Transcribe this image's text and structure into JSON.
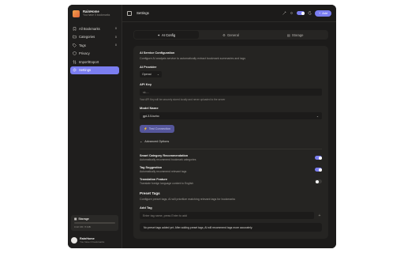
{
  "brand": {
    "title": "RainHome",
    "subtitle": "You have 0 bookmarks"
  },
  "sidebar": {
    "items": [
      {
        "label": "All Bookmarks",
        "count": "0",
        "icon": "bookmark-icon"
      },
      {
        "label": "Categories",
        "count": "0",
        "icon": "folder-icon"
      },
      {
        "label": "Tags",
        "count": "0",
        "icon": "tag-icon"
      },
      {
        "label": "Privacy",
        "count": "",
        "icon": "shield-icon"
      },
      {
        "label": "Import/Export",
        "count": "",
        "icon": "import-export-icon"
      },
      {
        "label": "Settings",
        "count": "",
        "icon": "gear-icon",
        "active": true
      }
    ]
  },
  "storage": {
    "title": "Storage",
    "usage": "0.02 KB / 5 MB"
  },
  "user": {
    "name": "RainHome",
    "subtitle": "You have 0 bookmarks"
  },
  "topbar": {
    "title": "Settings",
    "add_label": "Add"
  },
  "tabs": [
    {
      "label": "AI Config",
      "active": true
    },
    {
      "label": "General",
      "active": false
    },
    {
      "label": "Storage",
      "active": false
    }
  ],
  "ai": {
    "section_title": "AI Service Configuration",
    "section_desc": "Configure AI analysis service to automatically extract bookmark summaries and tags",
    "provider_label": "AI Provider",
    "provider_value": "Openai",
    "apikey_label": "API Key",
    "apikey_placeholder": "sk-...",
    "apikey_hint": "Your API Key will be securely stored locally and never uploaded to the server",
    "model_label": "Model Name",
    "model_value": "gpt-3.5-turbo",
    "test_label": "Test Connection",
    "advanced_label": "Advanced Options"
  },
  "toggles": [
    {
      "title": "Smart Category Recommendation",
      "desc": "Automatically recommend bookmark categories",
      "on": true
    },
    {
      "title": "Tag Suggestion",
      "desc": "Automatically recommend relevant tags",
      "on": true
    },
    {
      "title": "Translation Feature",
      "desc": "Translate foreign language content to English",
      "on": false
    }
  ],
  "preset": {
    "title": "Preset Tags",
    "desc": "Configure preset tags, AI will prioritize matching relevant tags for bookmarks",
    "add_label": "Add Tag",
    "input_placeholder": "Enter tag name, press Enter to add",
    "empty_text": "No preset tags added yet. After adding preset tags, AI will recommend tags more accurately."
  },
  "colors": {
    "accent": "#7b7ef0",
    "background": "#1c1b1a",
    "panel": "#252422"
  }
}
